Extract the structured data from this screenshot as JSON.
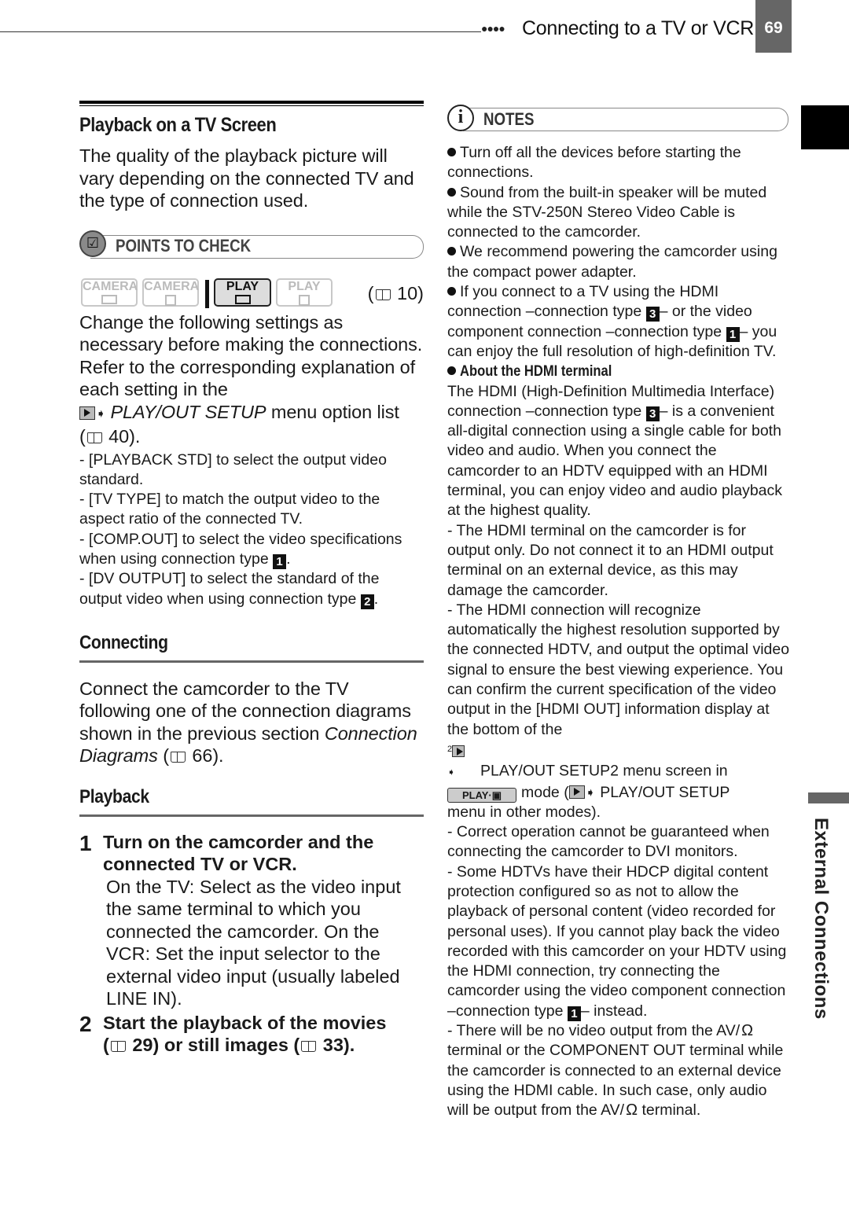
{
  "header": {
    "dots": "●●●●",
    "section_title": "Connecting to a TV or VCR",
    "page_number": "69"
  },
  "side_tab": {
    "label": "External Connections"
  },
  "left": {
    "title": "Playback on a TV Screen",
    "intro": "The quality of the playback picture will vary depending on the connected TV and the type of connection used.",
    "points_to_check": {
      "label": "POINTS TO CHECK",
      "modes": [
        {
          "label": "CAMERA",
          "media": "tape",
          "active": false
        },
        {
          "label": "CAMERA",
          "media": "card",
          "active": false
        },
        {
          "label": "PLAY",
          "media": "tape",
          "active": true
        },
        {
          "label": "PLAY",
          "media": "card",
          "active": false
        }
      ],
      "ref_page": "10"
    },
    "settings_intro_a": "Change the following settings as necessary before making the connections. Refer to the corresponding explanation of each setting in the",
    "settings_intro_menu": "PLAY/OUT SETUP",
    "settings_intro_b": " menu option list",
    "settings_ref_page": "40",
    "settings": [
      {
        "text_a": "-  [PLAYBACK STD] to select the output video standard.",
        "ctype": null
      },
      {
        "text_a": "-  [TV TYPE] to match the output video to the aspect ratio of the connected TV.",
        "ctype": null
      },
      {
        "text_a": "-  [COMP.OUT] to select the video specifications when using connection type ",
        "ctype": "1"
      },
      {
        "text_a": "-  [DV OUTPUT] to select the standard of the output video when using connection type ",
        "ctype": "2"
      }
    ],
    "connecting": {
      "heading": "Connecting",
      "text_a": "Connect the camcorder to the TV following one of the connection diagrams shown in the previous section ",
      "text_italic": "Connection Diagrams",
      "ref_page": "66"
    },
    "playback": {
      "heading": "Playback",
      "steps": [
        {
          "num": "1",
          "title": "Turn on the camcorder and the connected TV or VCR.",
          "body": "On the TV: Select as the video input the same terminal to which you connected the camcorder. On the VCR: Set the input selector to the external video input (usually labeled LINE IN)."
        },
        {
          "num": "2",
          "title_a": "Start the playback of the movies",
          "ref_movies": "29",
          "title_b": "or still images",
          "ref_stills": "33"
        }
      ]
    }
  },
  "notes": {
    "label": "NOTES",
    "items": [
      "Turn off all the devices before starting the connections.",
      "Sound from the built-in speaker will be muted while the STV-250N Stereo Video Cable is connected to the camcorder.",
      "We recommend powering the camcorder using the compact power adapter."
    ],
    "hdmi_note": {
      "a": "If you connect to a TV using the HDMI connection –connection type ",
      "ctype_a": "3",
      "b": "– or the video component connection –connection type ",
      "ctype_b": "1",
      "c": "– you can enjoy the full resolution of high-definition TV."
    },
    "about_hdmi": {
      "heading": "About the HDMI terminal",
      "intro_a": "The HDMI (High-Definition Multimedia Interface) connection –connection type ",
      "intro_ctype": "3",
      "intro_b": "– is a convenient all-digital connection using a single cable for both video and audio. When you connect the camcorder to an HDTV equipped with an HDMI terminal, you can enjoy video and audio playback at the highest quality.",
      "d1": "-  The HDMI terminal on the camcorder is for output only. Do not connect it to an HDMI output terminal on an external device, as this may damage the camcorder.",
      "d2_a": "-  The HDMI connection will recognize automatically the highest resolution supported by the connected HDTV, and output the optimal video signal to ensure the best viewing experience. You can confirm the current specification of the video output in the [HDMI OUT] information display at the bottom of the",
      "d2_menu2": "PLAY/OUT SETUP2 menu screen in",
      "d2_mode": "PLAY·▣",
      "d2_b": "mode (",
      "d2_menu": "PLAY/OUT SETUP",
      "d2_c": "menu in other modes).",
      "d3": "-  Correct operation cannot be guaranteed when connecting the camcorder to DVI monitors.",
      "d4_a": "-  Some HDTVs have their HDCP digital content protection configured so as not to allow the playback of personal content (video recorded for personal uses). If you cannot play back the video recorded with this camcorder on your HDTV using the HDMI connection, try connecting the camcorder using the video component connection –connection type ",
      "d4_ctype": "1",
      "d4_b": "– instead.",
      "d5_a": "-  There will be no video output from the AV/",
      "d5_b": " terminal or the COMPONENT OUT terminal while the camcorder is connected to an external device using the HDMI cable. In such case, only audio will be output from the AV/",
      "d5_c": " terminal."
    }
  },
  "icons": {
    "book": "book-icon",
    "headphones": "Ω",
    "arrow": "❖"
  }
}
